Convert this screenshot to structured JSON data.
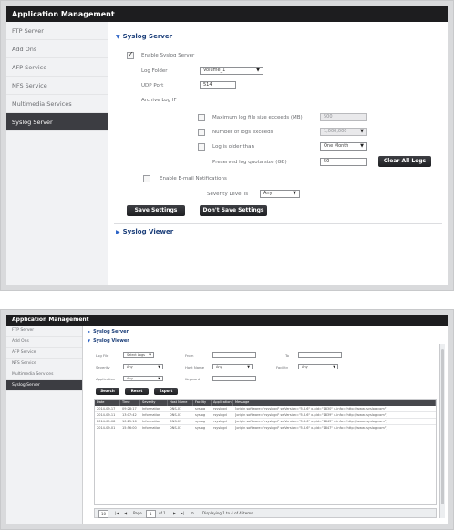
{
  "shot1": {
    "title": "Application Management",
    "sidebar": [
      {
        "label": "FTP Server",
        "active": false
      },
      {
        "label": "Add Ons",
        "active": false
      },
      {
        "label": "AFP Service",
        "active": false
      },
      {
        "label": "NFS Service",
        "active": false
      },
      {
        "label": "Multimedia Services",
        "active": false
      },
      {
        "label": "Syslog Server",
        "active": true
      }
    ],
    "syslog_server": {
      "heading": "Syslog Server",
      "enable_label": "Enable Syslog Server",
      "enable_checked": true,
      "log_folder_label": "Log Folder",
      "log_folder_value": "Volume_1",
      "udp_port_label": "UDP Port",
      "udp_port_value": "514",
      "archive_label": "Archive Log IF",
      "max_size_label": "Maximum log file size exceeds (MB)",
      "max_size_value": "500",
      "num_logs_label": "Number of logs exceeds",
      "num_logs_value": "1,000,000",
      "log_older_label": "Log is older than",
      "log_older_value": "One Month",
      "preserved_label": "Preserved log quota size (GB)",
      "preserved_value": "50",
      "clear_button": "Clear All Logs",
      "email_label": "Enable E-mail Notifications",
      "severity_label": "Severity Level is",
      "severity_value": "Any",
      "save_button": "Save Settings",
      "dont_save_button": "Don't Save Settings"
    },
    "syslog_viewer_heading": "Syslog Viewer"
  },
  "shot2": {
    "title": "Application Management",
    "sidebar": [
      {
        "label": "FTP Server"
      },
      {
        "label": "Add Ons"
      },
      {
        "label": "AFP Service"
      },
      {
        "label": "NFS Service"
      },
      {
        "label": "Multimedia Services"
      },
      {
        "label": "Syslog Server"
      }
    ],
    "server_heading": "Syslog Server",
    "viewer_heading": "Syslog Viewer",
    "filters": {
      "log_file_label": "Log File",
      "log_file_value": "Select Logs",
      "from_label": "From",
      "to_label": "To",
      "severity_label": "Severity",
      "severity_value": "Any",
      "host_name_label": "Host Name",
      "host_name_value": "Any",
      "facility_label": "Facility",
      "facility_value": "Any",
      "application_label": "Application",
      "application_value": "Any",
      "keyword_label": "Keyword"
    },
    "buttons": {
      "search": "Search",
      "reset": "Reset",
      "export": "Export"
    },
    "columns": [
      "Date",
      "Time",
      "Severity",
      "Host Name",
      "Facility",
      "Application",
      "Message"
    ],
    "rows": [
      [
        "2014-09-17",
        "09:28:17",
        "Information",
        "DNS-01",
        "syslog",
        "rsyslogd",
        "[origin software=\"rsyslogd\" swVersion=\"5.8.6\" x-pid=\"1830\" x-info=\"http://www.rsyslog.com\"]"
      ],
      [
        "2014-09-11",
        "13:07:42",
        "Information",
        "DNS-01",
        "syslog",
        "rsyslogd",
        "[origin software=\"rsyslogd\" swVersion=\"5.8.6\" x-pid=\"1839\" x-info=\"http://www.rsyslog.com\"]"
      ],
      [
        "2014-09-08",
        "10:25:16",
        "Information",
        "DNS-01",
        "syslog",
        "rsyslogd",
        "[origin software=\"rsyslogd\" swVersion=\"5.8.6\" x-pid=\"1843\" x-info=\"http://www.rsyslog.com\"]"
      ],
      [
        "2014-09-01",
        "15:56:00",
        "Information",
        "DNS-01",
        "syslog",
        "rsyslogd",
        "[origin software=\"rsyslogd\" swVersion=\"5.8.6\" x-pid=\"1847\" x-info=\"http://www.rsyslog.com\"]"
      ]
    ],
    "pager": {
      "per_page": "10",
      "page_label": "Page",
      "page_value": "1",
      "of_label": "of 1",
      "status": "Displaying 1 to 4 of 4 items"
    }
  }
}
